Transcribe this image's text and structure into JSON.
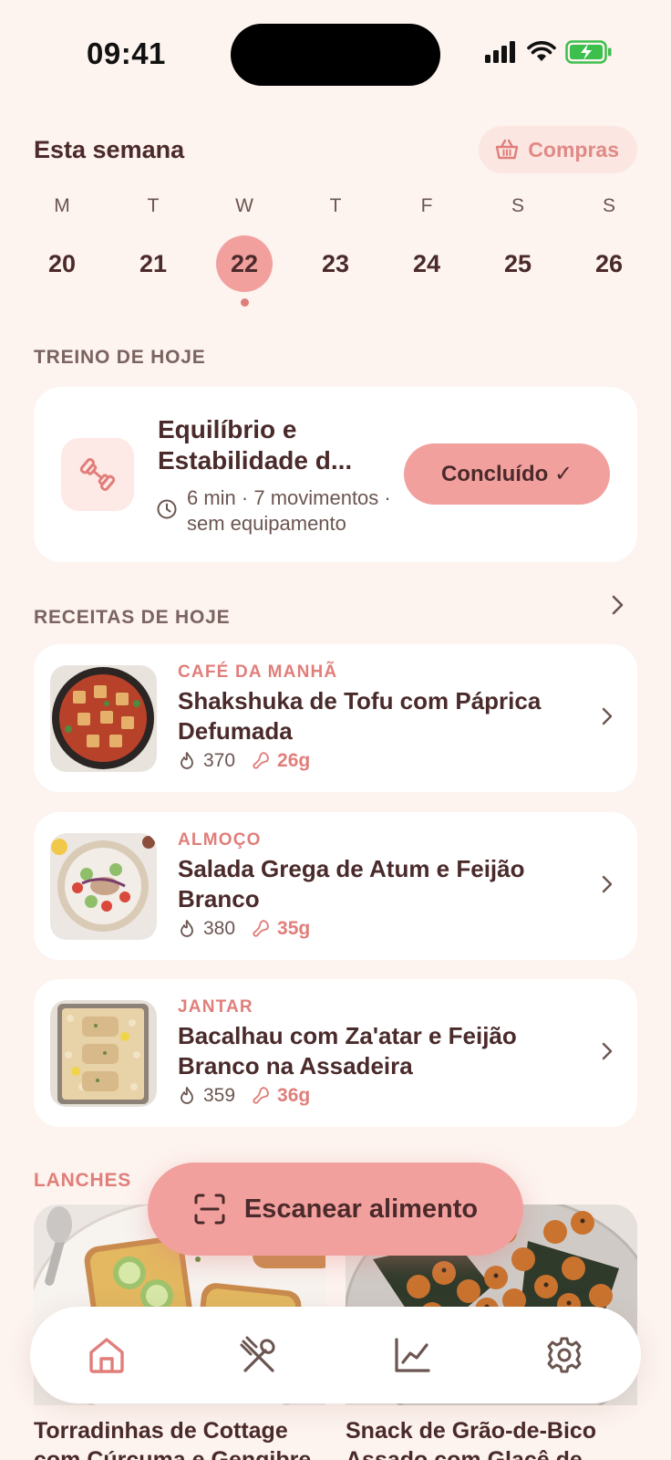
{
  "status": {
    "time": "09:41"
  },
  "week": {
    "title": "Esta semana",
    "shop_label": "Compras",
    "days": [
      {
        "letter": "M",
        "num": "20",
        "active": false
      },
      {
        "letter": "T",
        "num": "21",
        "active": false
      },
      {
        "letter": "W",
        "num": "22",
        "active": true
      },
      {
        "letter": "T",
        "num": "23",
        "active": false
      },
      {
        "letter": "F",
        "num": "24",
        "active": false
      },
      {
        "letter": "S",
        "num": "25",
        "active": false
      },
      {
        "letter": "S",
        "num": "26",
        "active": false
      }
    ]
  },
  "workout": {
    "section": "TREINO DE HOJE",
    "title": "Equilíbrio e Estabilidade d...",
    "meta": "6 min · 7 movimentos · sem equipamento",
    "done_label": "Concluído ✓"
  },
  "recipes": {
    "section": "RECEITAS DE HOJE",
    "items": [
      {
        "type": "CAFÉ DA MANHÃ",
        "name": "Shakshuka de Tofu com Páprica Defumada",
        "kcal": "370",
        "protein": "26g"
      },
      {
        "type": "ALMOÇO",
        "name": "Salada Grega de Atum e Feijão Branco",
        "kcal": "380",
        "protein": "35g"
      },
      {
        "type": "JANTAR",
        "name": "Bacalhau com Za'atar e Feijão Branco na Assadeira",
        "kcal": "359",
        "protein": "36g"
      }
    ]
  },
  "snacks": {
    "section": "LANCHES",
    "items": [
      {
        "name": "Torradinhas de Cottage com Cúrcuma e Gengibre"
      },
      {
        "name": "Snack de Grão-de-Bico Assado com Glacê de"
      }
    ]
  },
  "scan_label": "Escanear alimento",
  "tabs": [
    {
      "icon": "home-icon",
      "active": true
    },
    {
      "icon": "utensils-icon",
      "active": false
    },
    {
      "icon": "chart-icon",
      "active": false
    },
    {
      "icon": "gear-icon",
      "active": false
    }
  ],
  "colors": {
    "accent": "#f2a09e",
    "accent_text": "#e07e7a",
    "background": "#fdf3ef"
  }
}
